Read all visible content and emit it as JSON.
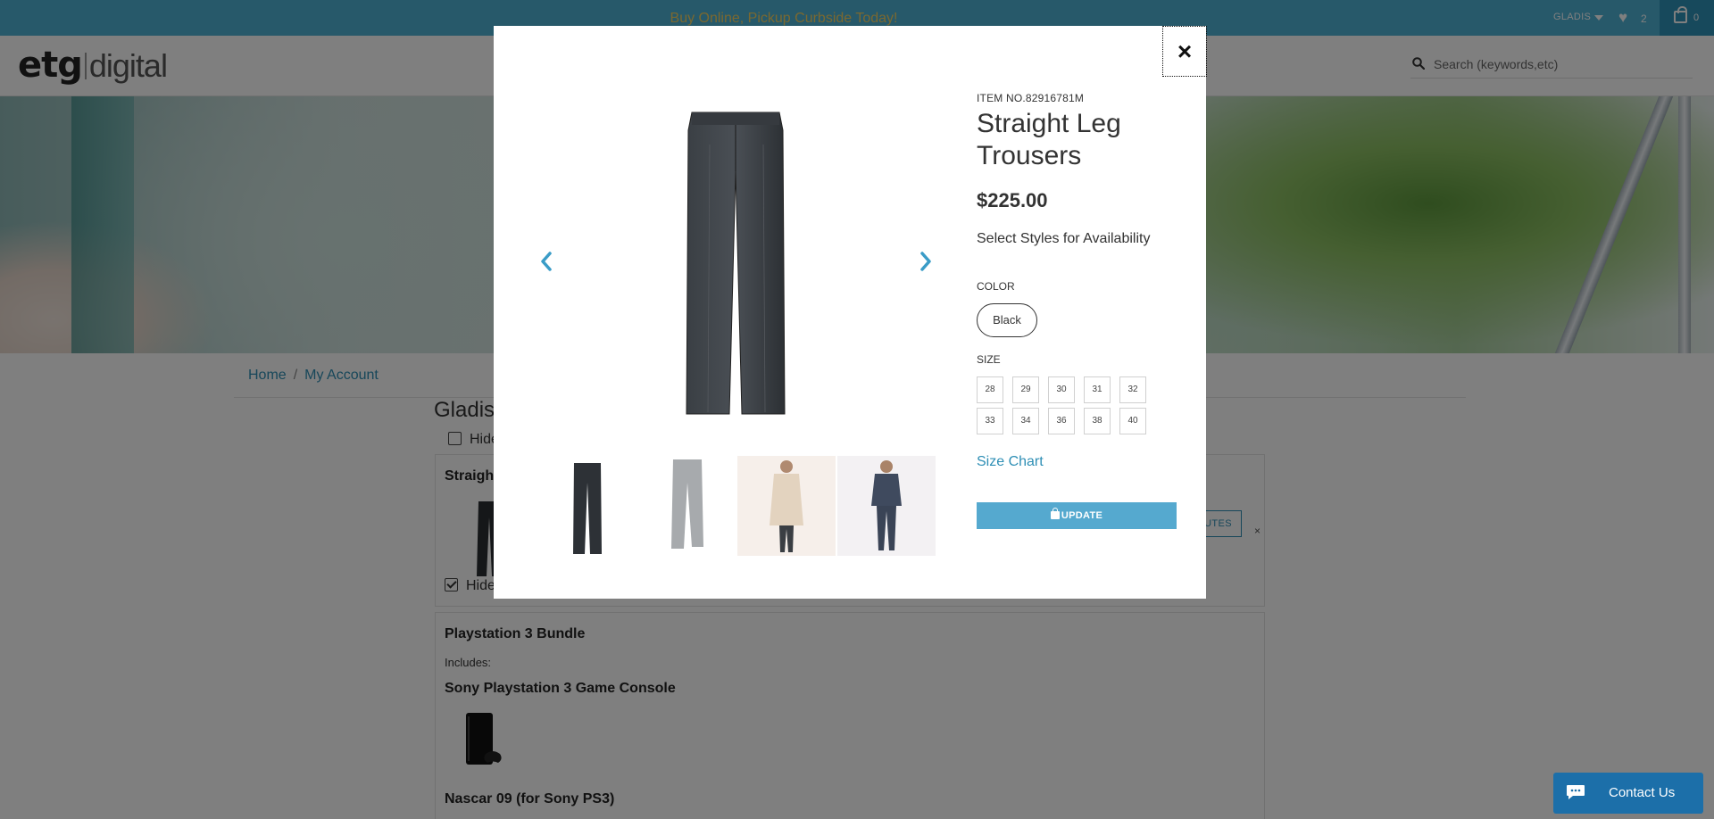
{
  "topbar": {
    "promo": "Buy Online, Pickup Curbside Today!",
    "user_name": "GLADIS",
    "wishlist_count": "2",
    "cart_count": "0",
    "colors": {
      "bar": "#4fb3d4",
      "promo_text": "#f4d060",
      "cart_bg": "#2e93b8"
    }
  },
  "header": {
    "logo_part1": "etg",
    "logo_part2": "digital",
    "search_placeholder": "Search (keywords,etc)"
  },
  "breadcrumb": {
    "items": [
      "Home",
      "My Account"
    ],
    "separator": "/"
  },
  "wishlist": {
    "title": "Gladis'",
    "hide_label": "Hide",
    "items": [
      {
        "name": "Straight",
        "hide_label": "Hide",
        "hide_checked": true,
        "attributes_button": "UTES",
        "remove": "×"
      },
      {
        "name": "Playstation 3 Bundle",
        "includes_label": "Includes:",
        "components": [
          "Sony Playstation 3 Game Console",
          "Nascar 09 (for Sony PS3)"
        ]
      }
    ]
  },
  "modal": {
    "close": "×",
    "item_number": "ITEM NO.82916781M",
    "product_title": "Straight Leg Trousers",
    "price": "$225.00",
    "availability": "Select Styles for Availability",
    "color_label": "COLOR",
    "color_selected": "Black",
    "size_label": "SIZE",
    "sizes": [
      "28",
      "29",
      "30",
      "31",
      "32",
      "33",
      "34",
      "36",
      "38",
      "40"
    ],
    "size_chart": "Size Chart",
    "update_button": "UPDATE",
    "thumbnails": [
      "dark-trousers",
      "grey-trousers",
      "model-coat",
      "model-suit"
    ]
  },
  "chat": {
    "label": "Contact Us",
    "color": "#1c6fa9"
  },
  "colors": {
    "accent": "#2f8fb5",
    "update_button": "#55a9cf"
  }
}
